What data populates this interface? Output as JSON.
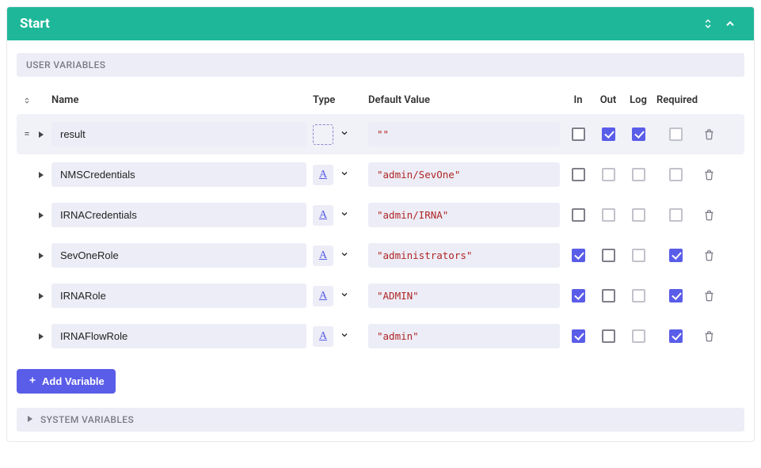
{
  "panel": {
    "title": "Start"
  },
  "sections": {
    "user_vars_label": "USER VARIABLES",
    "system_vars_label": "SYSTEM VARIABLES"
  },
  "columns": {
    "name": "Name",
    "type": "Type",
    "default": "Default Value",
    "in": "In",
    "out": "Out",
    "log": "Log",
    "required": "Required"
  },
  "add_button": "Add Variable",
  "vars": [
    {
      "selected": true,
      "show_eq": true,
      "name": "result",
      "type_glyph": "",
      "type_dashed": true,
      "default": "\"\"",
      "in": false,
      "out": true,
      "log": true,
      "required": false,
      "required_dim": true
    },
    {
      "selected": false,
      "show_eq": false,
      "name": "NMSCredentials",
      "type_glyph": "A",
      "type_dashed": false,
      "default": "\"admin/SevOne\"",
      "in": false,
      "out": false,
      "log": false,
      "required": false,
      "required_dim": true,
      "log_dim": true,
      "out_dim": true
    },
    {
      "selected": false,
      "show_eq": false,
      "name": "IRNACredentials",
      "type_glyph": "A",
      "type_dashed": false,
      "default": "\"admin/IRNA\"",
      "in": false,
      "out": false,
      "log": false,
      "required": false,
      "required_dim": true,
      "log_dim": true,
      "out_dim": true
    },
    {
      "selected": false,
      "show_eq": false,
      "name": "SevOneRole",
      "type_glyph": "A",
      "type_dashed": false,
      "default": "\"administrators\"",
      "in": true,
      "out": false,
      "log": false,
      "required": true,
      "log_dim": true
    },
    {
      "selected": false,
      "show_eq": false,
      "name": "IRNARole",
      "type_glyph": "A",
      "type_dashed": false,
      "default": "\"ADMIN\"",
      "in": true,
      "out": false,
      "log": false,
      "required": true,
      "log_dim": true
    },
    {
      "selected": false,
      "show_eq": false,
      "name": "IRNAFlowRole",
      "type_glyph": "A",
      "type_dashed": false,
      "default": "\"admin\"",
      "in": true,
      "out": false,
      "log": false,
      "required": true,
      "log_dim": true
    }
  ]
}
